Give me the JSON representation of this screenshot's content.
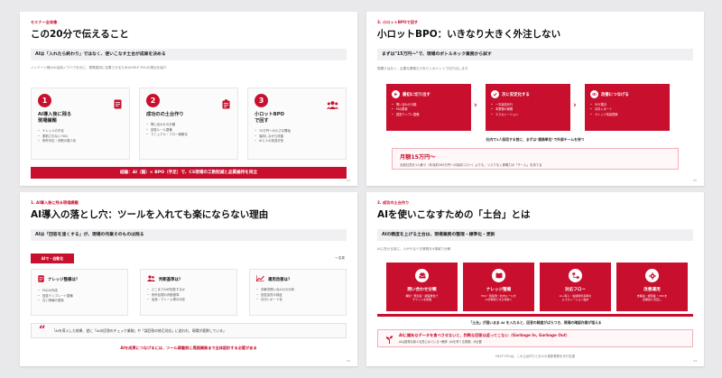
{
  "colors": {
    "accent": "#c8102e",
    "card_bg": "#fbfbfc",
    "band_bg": "#f0f0f3",
    "canvas_bg": "#e9e9ec"
  },
  "slide1": {
    "tag": "セミナー全体像",
    "title": "この20分で伝えること",
    "band": "AIは「入れたら終わり」ではなく、使いこなす土台が成果を決める",
    "subnote": "インテージ様のAI活用ノウハウを元に、現場運用に定着させるためのHELP YOUの視点を紹介",
    "cards": [
      {
        "num": "1",
        "icon": "document-icon",
        "title_lines": [
          "AI導入後に残る",
          "現場課題"
        ],
        "bullets": [
          "ナレッジの不足",
          "更新されない FAQ",
          "例外対応・判断の属人化"
        ]
      },
      {
        "num": "2",
        "icon": "clipboard-icon",
        "title_lines": [
          "成功のの土台作り"
        ],
        "bullets": [
          "問い合わせの分類",
          "回答ルール整備",
          "マニュアル・フロー構築化"
        ]
      },
      {
        "num": "3",
        "icon": "team-icon",
        "title_lines": [
          "小ロットBPO",
          "で回す"
        ],
        "bullets": [
          "15万円〜の小さな開始",
          "運用しながら改善",
          "AIと人の役割分担"
        ]
      }
    ],
    "footer": "結論：AI（脳）× BPO（手足）で、CS現場の工数削減と品質維持を両立",
    "page": "02"
  },
  "slide2": {
    "tag": "3. 小ロットBPOで回す",
    "title": "小ロットBPO：いきなり大きく外注しない",
    "band": "まずは\"15万円〜\"で、現場のボトルネック業務から試す",
    "subnote": "規模ではなく、必要な業務だけをピンポイントで切り出します",
    "flows": [
      {
        "icon": "play-icon",
        "title": "最初に切り出す",
        "bullets": [
          "問い合わせ分類",
          "FAQ更新",
          "回答テンプレ整備"
        ]
      },
      {
        "icon": "check-icon",
        "title": "次に安定化する",
        "bullets": [
          "一次返信代行",
          "本業務の管理",
          "エスカレーション"
        ]
      },
      {
        "icon": "link-icon",
        "title": "改善につなげる",
        "bullets": [
          "VOC集計",
          "月次レポート",
          "ナレッジ改善提案"
        ]
      }
    ],
    "center_note": "社内で1人採用する前に、まずは\"業務単位\"で外部チームを持つ",
    "price_main": "月額15万円〜",
    "price_sub": "派遣社員を1人雇う（年収約300万円〜の採用コスト）よりも、リスクなく即戦力の「チーム」を持てる",
    "page": "05"
  },
  "slide3": {
    "tag": "1. AI導入後に残る現場課題",
    "title": "AI導入の落とし穴：ツールを入れても楽にならない理由",
    "band": "AIは「回答を速くする」が、現場の作業そのものは残る",
    "pill": "AIで・自動化",
    "arrow_note": "→ 成果",
    "cards": [
      {
        "icon": "document-icon",
        "title": "ナレッジ整備は？",
        "bullets": [
          "FAQの作成",
          "回答テンプレート整備",
          "古い情報の更新"
        ]
      },
      {
        "icon": "people-icon",
        "title": "判断基準は？",
        "bullets": [
          "どこまでAIが回答するか",
          "例外処理の判断基準",
          "返品・クレーム等の対応"
        ]
      },
      {
        "icon": "chart-icon",
        "title": "運用改善は？",
        "bullets": [
          "未解決問い合わせの分析",
          "回答品質の検証",
          "月次レポート化"
        ]
      }
    ],
    "quote": "「AIを導入した結果、逆に「AIの回答のチェック業務」や「誤回答の修正対応」に追われ、現場が疲弊している」",
    "conclusion": "AIを成果につなげるには、ツール稼働前に周囲業務まで全体設計する必要がある",
    "page": "03"
  },
  "slide4": {
    "tag": "2. 成功の土台作り",
    "title": "AIを使いこなすための「土台」とは",
    "band": "AIの精度を上げる土台は、現場業務の整理・標準化・更新",
    "subnote": "AIに任せる前に、人がやるべき業務を4領域で分解",
    "pillars": [
      {
        "icon": "inbox-icon",
        "title": "問い合わせ分類",
        "desc_lines": [
          "種別・緊急度・顧客属性で",
          "チケットを整理"
        ]
      },
      {
        "icon": "book-icon",
        "title": "ナレッジ整備",
        "desc_lines": [
          "FAQ・回答例・社内ルールを",
          "AIが参照できる状態へ"
        ]
      },
      {
        "icon": "flow-icon",
        "title": "対応フロー",
        "desc_lines": [
          "AI→有人・電話移管基準の",
          "エスカレーション設計"
        ]
      },
      {
        "icon": "gear-icon",
        "title": "改善運用",
        "desc_lines": [
          "未解決・誤回答・VOCを",
          "定期的に見直し"
        ]
      }
    ],
    "center_note": "「土台」が固いまま AI を入れると、回答の精度がばらつき、現場の確認作業が増える",
    "warn_main": "AIに雑糸なデータを食べさせないと、判断な回答は返ってこない（Garbage In, Garbage Out）",
    "warn_sub": "AIは優秀な新人社員に似ている→教師（AIを育てる業務）が必要",
    "bottom_note": "HELP YOUは、この土台作りと日々の更新業務を代行支援",
    "page": "04"
  }
}
